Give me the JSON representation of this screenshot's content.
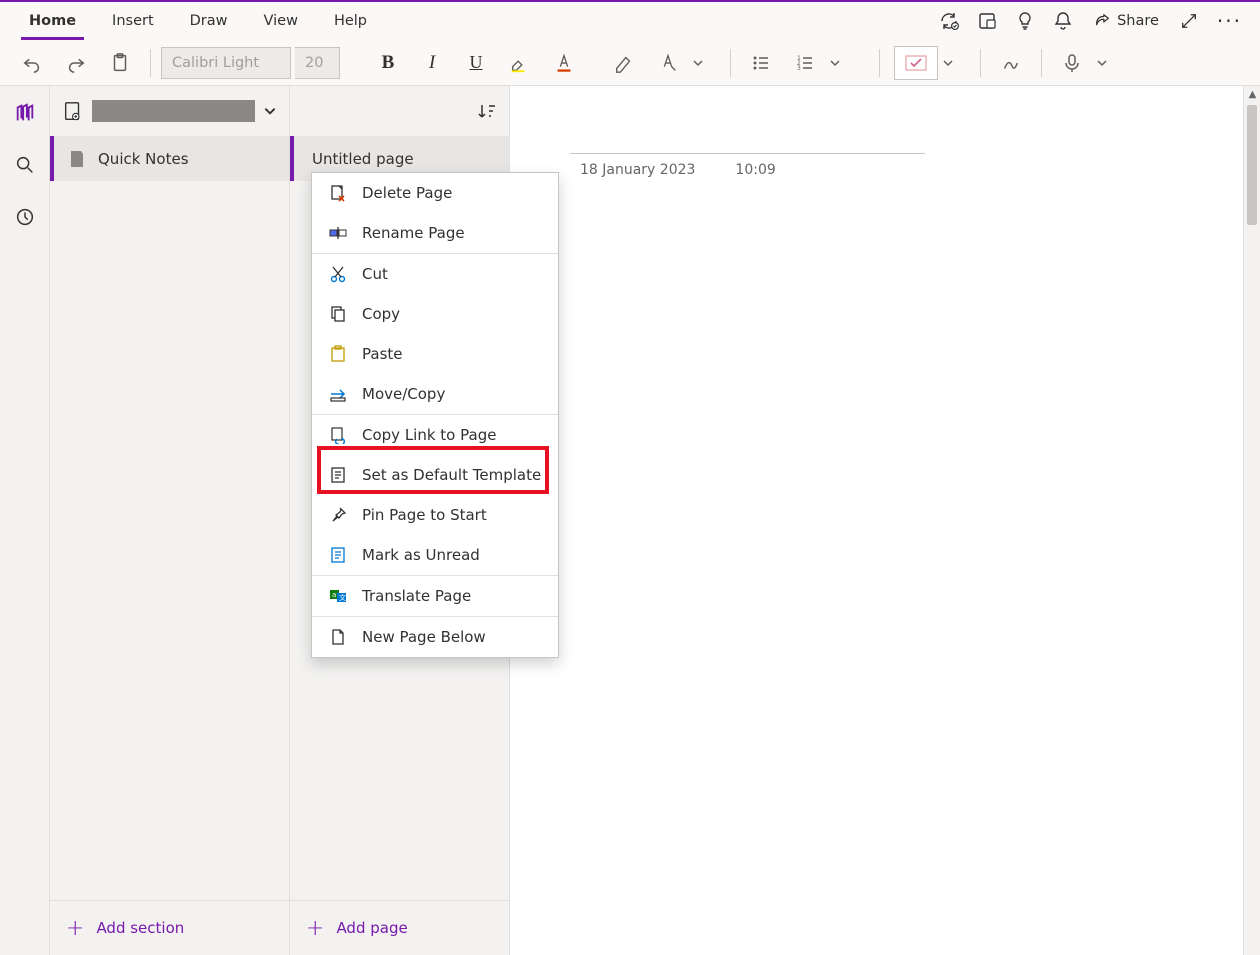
{
  "ribbon": {
    "tabs": [
      "Home",
      "Insert",
      "Draw",
      "View",
      "Help"
    ],
    "active_tab": "Home",
    "share_label": "Share",
    "font_name": "Calibri Light",
    "font_size": "20"
  },
  "notebook": {
    "name_redacted": true,
    "section": "Quick Notes",
    "page_title": "Untitled page",
    "add_section_label": "Add section",
    "add_page_label": "Add page"
  },
  "page": {
    "date": "18 January 2023",
    "time": "10:09"
  },
  "context_menu": {
    "items": [
      {
        "label": "Delete Page",
        "icon": "delete-page"
      },
      {
        "label": "Rename Page",
        "icon": "rename"
      },
      {
        "label": "Cut",
        "icon": "cut",
        "sep_before": true
      },
      {
        "label": "Copy",
        "icon": "copy"
      },
      {
        "label": "Paste",
        "icon": "paste"
      },
      {
        "label": "Move/Copy",
        "icon": "move"
      },
      {
        "label": "Copy Link to Page",
        "icon": "link",
        "sep_before": true
      },
      {
        "label": "Set as Default Template",
        "icon": "template",
        "highlighted": true
      },
      {
        "label": "Pin Page to Start",
        "icon": "pin"
      },
      {
        "label": "Mark as Unread",
        "icon": "unread"
      },
      {
        "label": "Translate Page",
        "icon": "translate",
        "sep_before": true
      },
      {
        "label": "New Page Below",
        "icon": "new-page",
        "sep_before": true
      }
    ]
  }
}
